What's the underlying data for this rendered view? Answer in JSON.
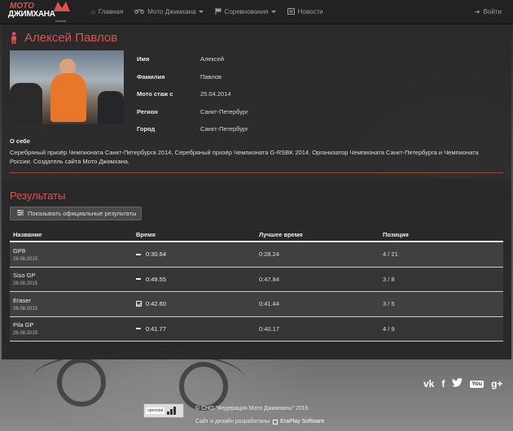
{
  "brand": {
    "line1": "МОТО",
    "line2": "ДЖИМХАНА",
    "line3": "РОССИИ"
  },
  "navbar": {
    "items": [
      {
        "label": "Главная",
        "icon": "home-icon"
      },
      {
        "label": "Мото Джимхана",
        "icon": "motorcycle-icon",
        "dropdown": true
      },
      {
        "label": "Соревнования",
        "icon": "flag-icon",
        "dropdown": true
      },
      {
        "label": "Новости",
        "icon": "newspaper-icon"
      }
    ],
    "login": {
      "label": "Войти",
      "icon": "login-icon"
    }
  },
  "profile": {
    "name": "Алексей Павлов",
    "fields": [
      {
        "key": "Имя",
        "value": "Алексей"
      },
      {
        "key": "Фамилия",
        "value": "Павлов"
      },
      {
        "key": "Мото стаж с",
        "value": "25.04.2014"
      },
      {
        "key": "Регион",
        "value": "Санкт-Петербург"
      },
      {
        "key": "Город",
        "value": "Санкт-Петербург"
      }
    ],
    "about_heading": "О себе",
    "about_text": "Серебряный призёр Чемпионата Санкт-Петербурга 2014, Серебряный призёр Чемпионата G-RSBK 2014. Организатор Чемпионата Санкт-Петербурга и Чемпионата России. Создатель сайта Мото Джимхана."
  },
  "results": {
    "title": "Результаты",
    "official_button": "Показывать официальные результаты",
    "columns": [
      "Название",
      "Время",
      "Лучшее время",
      "Позиция"
    ],
    "rows": [
      {
        "name": "GP8",
        "date": "26.08.2015",
        "time": "0:30.64",
        "status": "minus",
        "best": "0:28.24",
        "position": "4 / 21"
      },
      {
        "name": "Siso GP",
        "date": "26.08.2015",
        "time": "0:49.55",
        "status": "minus",
        "best": "0:47.84",
        "position": "3 / 8"
      },
      {
        "name": "Eraser",
        "date": "26.08.2015",
        "time": "0:42.60",
        "status": "check",
        "best": "0:41.44",
        "position": "3 / 5"
      },
      {
        "name": "Pila GP",
        "date": "26.08.2015",
        "time": "0:41.77",
        "status": "minus",
        "best": "0:40.17",
        "position": "4 / 9"
      }
    ]
  },
  "footer": {
    "copyright": "© СНО \"Федерация Мото Джимханы\" 2015",
    "developed_by": "Сайт и дизайн разработаны",
    "developer": "EraPlay Software",
    "openstat": "openstat",
    "social": [
      "vk-icon",
      "facebook-icon",
      "twitter-icon",
      "youtube-icon",
      "google-plus-icon"
    ]
  },
  "colors": {
    "accent": "#d9534f",
    "navbar": "#222222"
  }
}
